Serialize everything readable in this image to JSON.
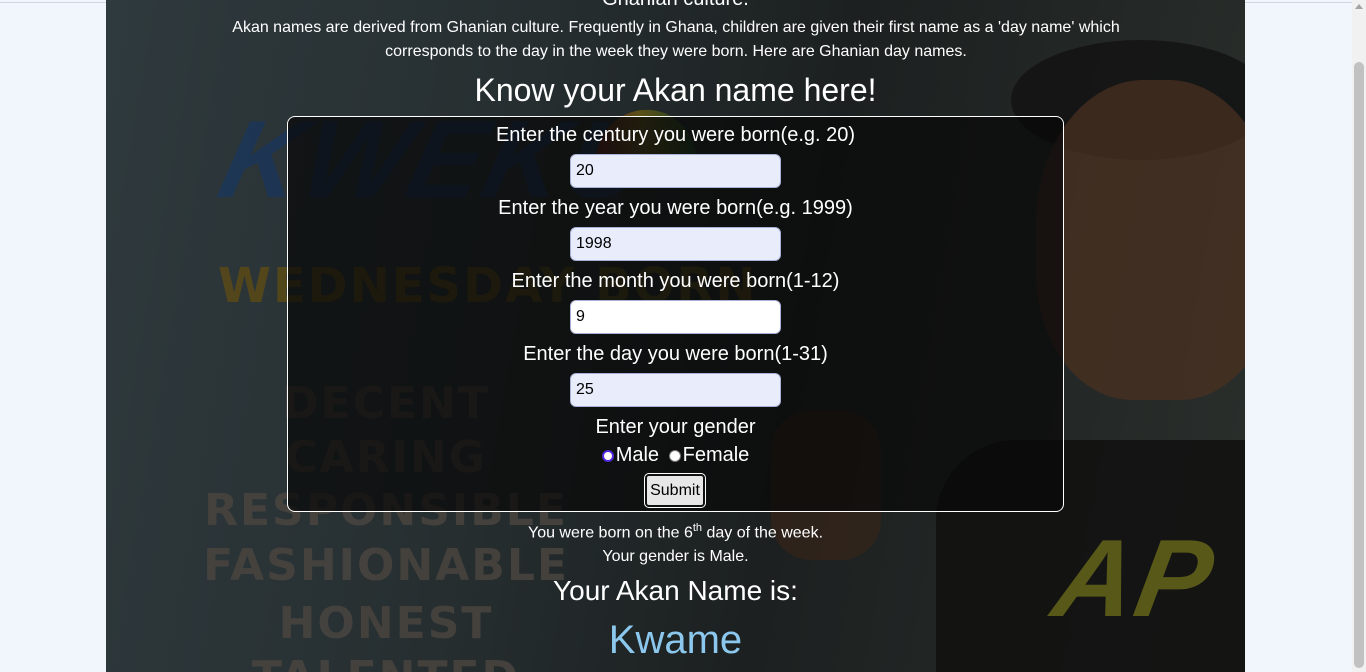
{
  "colors": {
    "page_bg": "#f1f6fd",
    "panel_bg": "#1e2424",
    "akan_name": "#8cc8ee",
    "radio_accent": "#4f2bd8"
  },
  "background_art": {
    "words": [
      "KWEKU",
      "WEDNESDAY BORN",
      "DECENT",
      "CARING",
      "RESPONSIBLE",
      "FASHIONABLE",
      "HONEST",
      "TALENTED",
      "AP"
    ]
  },
  "intro": {
    "heading_fragment": "Ghanian culture.",
    "paragraph": "Akan names are derived from Ghanian culture. Frequently in Ghana, children are given their first name as a 'day name' which corresponds to the day in the week they were born. Here are Ghanian day names."
  },
  "title": "Know your Akan name here!",
  "form": {
    "century": {
      "label": "Enter the century you were born(e.g. 20)",
      "value": "20"
    },
    "year": {
      "label": "Enter the year you were born(e.g. 1999)",
      "value": "1998"
    },
    "month": {
      "label": "Enter the month you were born(1-12)",
      "value": "9"
    },
    "day": {
      "label": "Enter the day you were born(1-31)",
      "value": "25"
    },
    "gender_label": "Enter your gender",
    "genders": [
      {
        "label": "Male",
        "selected": true
      },
      {
        "label": "Female",
        "selected": false
      }
    ],
    "submit_label": "Submit"
  },
  "result": {
    "born_prefix": "You were born on the ",
    "born_day": "6",
    "born_ordinal": "th",
    "born_suffix": " day of the week.",
    "gender_text": "Your gender is Male.",
    "akan_label": "Your Akan Name is:",
    "akan_name": "Kwame"
  }
}
